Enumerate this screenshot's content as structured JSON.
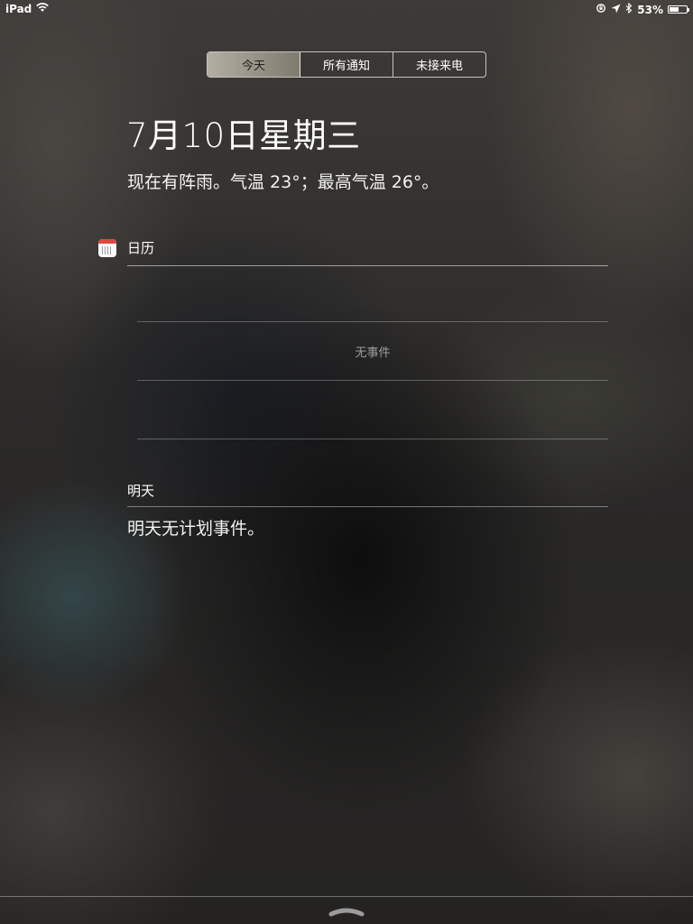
{
  "status_bar": {
    "device": "iPad",
    "battery_percent": "53%",
    "battery_level": 0.53,
    "icons": [
      "wifi-icon",
      "rotation-lock-icon",
      "location-arrow-icon",
      "bluetooth-icon",
      "battery-icon"
    ]
  },
  "tabs": [
    {
      "label": "今天",
      "selected": true
    },
    {
      "label": "所有通知",
      "selected": false
    },
    {
      "label": "未接来电",
      "selected": false
    }
  ],
  "today": {
    "date": "7月10日星期三",
    "weather": "现在有阵雨。气温 23°；最高气温 26°。"
  },
  "calendar": {
    "title": "日历",
    "empty_text": "无事件",
    "icon": "calendar-icon"
  },
  "tomorrow": {
    "title": "明天",
    "text": "明天无计划事件。"
  },
  "bottom": {
    "icon": "grabber-handle-icon"
  }
}
